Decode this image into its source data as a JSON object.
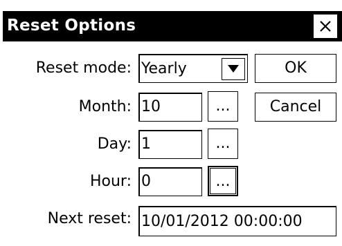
{
  "window": {
    "title": "Reset Options",
    "close_glyph": "close-icon"
  },
  "form": {
    "reset_mode": {
      "label": "Reset mode:",
      "value": "Yearly"
    },
    "month": {
      "label": "Month:",
      "value": "10"
    },
    "day": {
      "label": "Day:",
      "value": "1"
    },
    "hour": {
      "label": "Hour:",
      "value": "0"
    },
    "next_reset": {
      "label": "Next reset:",
      "value": "10/01/2012 00:00:00"
    }
  },
  "buttons": {
    "ok": "OK",
    "cancel": "Cancel",
    "ellipsis": "..."
  }
}
